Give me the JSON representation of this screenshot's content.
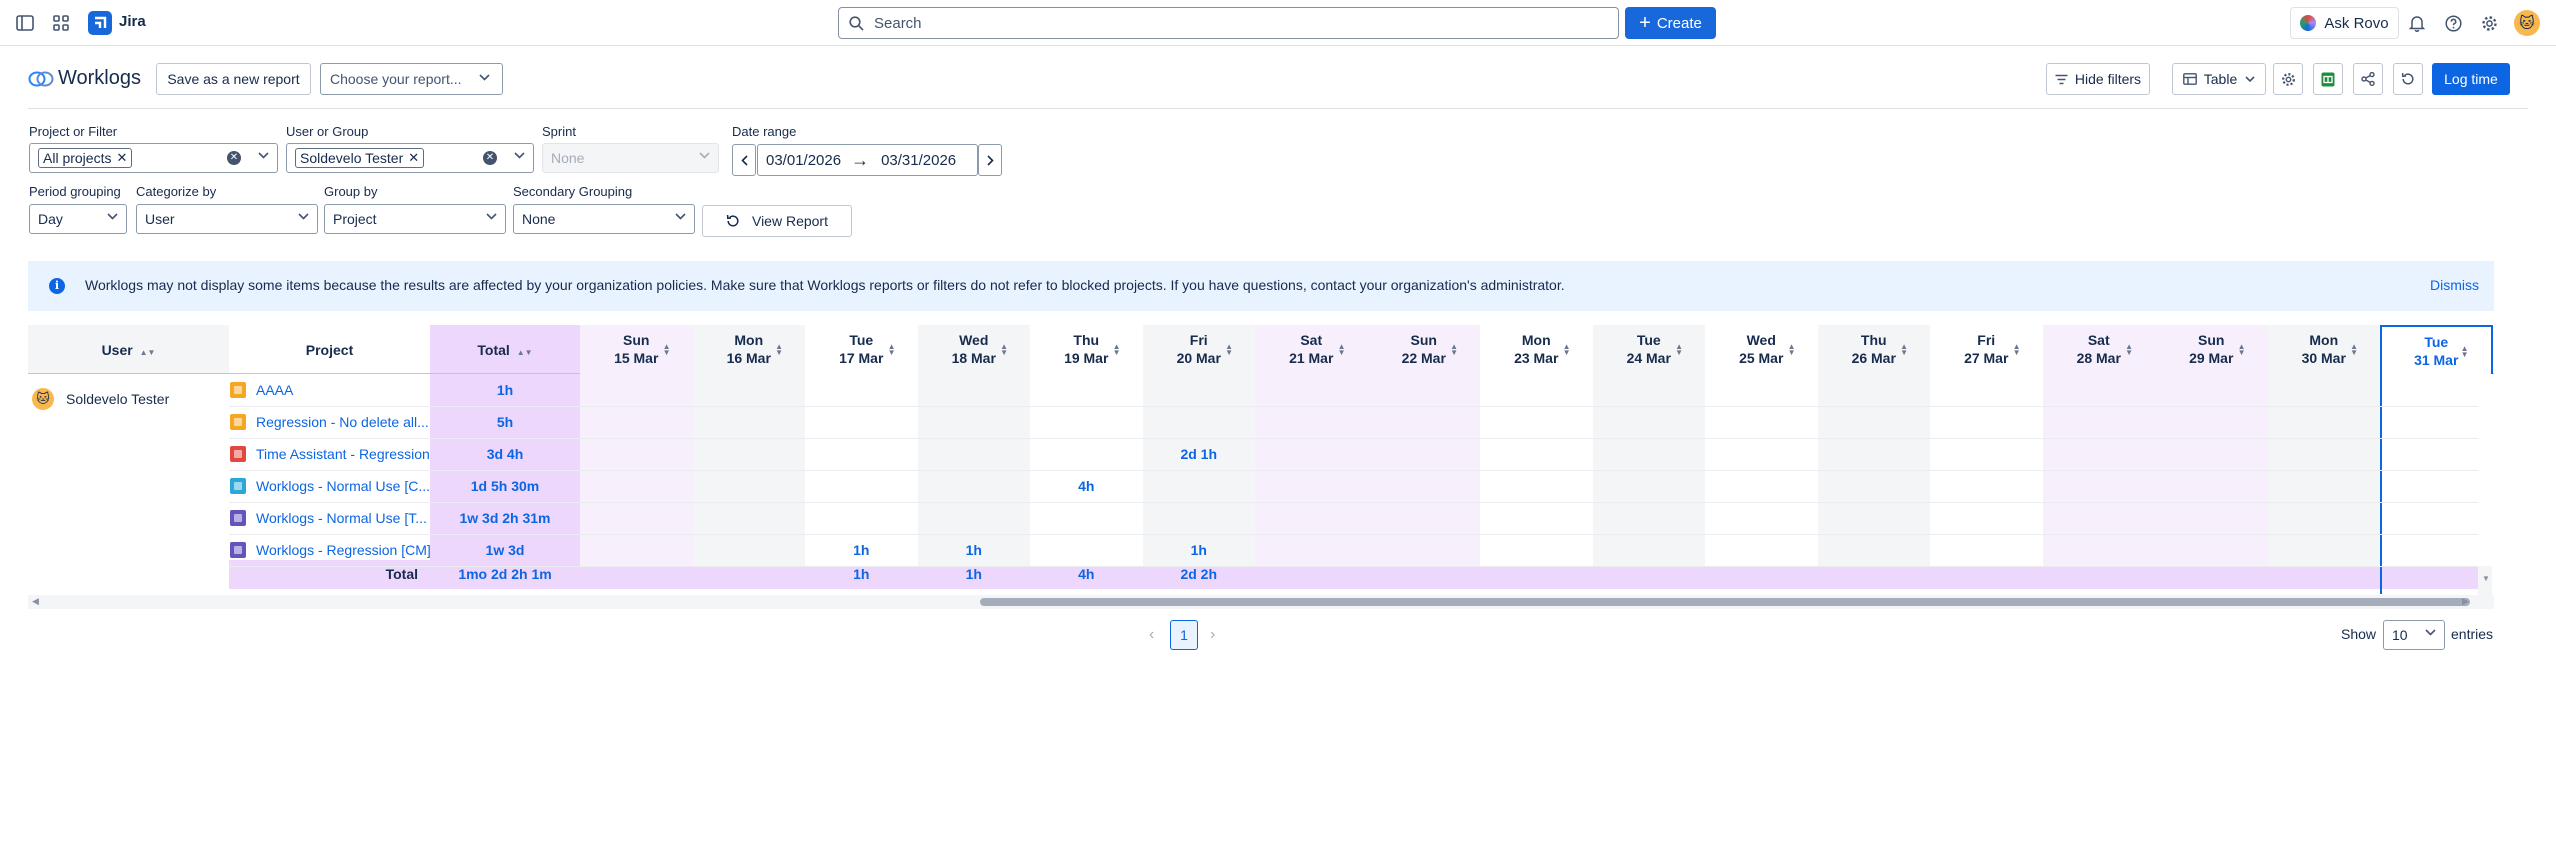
{
  "topnav": {
    "app_name": "Jira",
    "search_placeholder": "Search",
    "create_label": "Create",
    "ask_rovo_label": "Ask Rovo"
  },
  "header": {
    "title": "Worklogs",
    "save_new_report": "Save as a new report",
    "choose_report_placeholder": "Choose your report...",
    "hide_filters": "Hide filters",
    "view_mode": "Table",
    "log_time": "Log time"
  },
  "filters": {
    "project_label": "Project or Filter",
    "project_chip": "All projects",
    "user_label": "User or Group",
    "user_chip": "Soldevelo Tester",
    "sprint_label": "Sprint",
    "sprint_value": "None",
    "date_label": "Date range",
    "date_from": "03/01/2026",
    "date_to": "03/31/2026",
    "period_label": "Period grouping",
    "period_value": "Day",
    "categorize_label": "Categorize by",
    "categorize_value": "User",
    "group_label": "Group by",
    "group_value": "Project",
    "secondary_label": "Secondary Grouping",
    "secondary_value": "None",
    "view_report": "View Report"
  },
  "banner": {
    "message": "Worklogs may not display some items because the results are affected by your organization policies. Make sure that Worklogs reports or filters do not refer to blocked projects. If you have questions, contact your organization's administrator.",
    "dismiss": "Dismiss"
  },
  "table": {
    "col_user": "User",
    "col_project": "Project",
    "col_total": "Total",
    "days": [
      {
        "dow": "Sun",
        "date": "15 Mar",
        "weekend": true
      },
      {
        "dow": "Mon",
        "date": "16 Mar",
        "weekend": false
      },
      {
        "dow": "Tue",
        "date": "17 Mar",
        "weekend": false
      },
      {
        "dow": "Wed",
        "date": "18 Mar",
        "weekend": false
      },
      {
        "dow": "Thu",
        "date": "19 Mar",
        "weekend": false
      },
      {
        "dow": "Fri",
        "date": "20 Mar",
        "weekend": false
      },
      {
        "dow": "Sat",
        "date": "21 Mar",
        "weekend": true
      },
      {
        "dow": "Sun",
        "date": "22 Mar",
        "weekend": true
      },
      {
        "dow": "Mon",
        "date": "23 Mar",
        "weekend": false
      },
      {
        "dow": "Tue",
        "date": "24 Mar",
        "weekend": false
      },
      {
        "dow": "Wed",
        "date": "25 Mar",
        "weekend": false
      },
      {
        "dow": "Thu",
        "date": "26 Mar",
        "weekend": false
      },
      {
        "dow": "Fri",
        "date": "27 Mar",
        "weekend": false
      },
      {
        "dow": "Sat",
        "date": "28 Mar",
        "weekend": true
      },
      {
        "dow": "Sun",
        "date": "29 Mar",
        "weekend": true
      },
      {
        "dow": "Mon",
        "date": "30 Mar",
        "weekend": false
      },
      {
        "dow": "Tue",
        "date": "31 Mar",
        "weekend": false,
        "today": true
      }
    ],
    "user_name": "Soldevelo Tester",
    "rows": [
      {
        "project": "AAAA",
        "icon_color": "#f5a623",
        "total": "1h",
        "cells": [
          "",
          "",
          "",
          "",
          "",
          "",
          "",
          "",
          "",
          "",
          "",
          "",
          "",
          "",
          "",
          "",
          ""
        ]
      },
      {
        "project": "Regression - No delete all...",
        "icon_color": "#f5a623",
        "total": "5h",
        "cells": [
          "",
          "",
          "",
          "",
          "",
          "",
          "",
          "",
          "",
          "",
          "",
          "",
          "",
          "",
          "",
          "",
          ""
        ]
      },
      {
        "project": "Time Assistant - Regression",
        "icon_color": "#e2483d",
        "total": "3d 4h",
        "cells": [
          "",
          "",
          "",
          "",
          "",
          "2d 1h",
          "",
          "",
          "",
          "",
          "",
          "",
          "",
          "",
          "",
          "",
          ""
        ]
      },
      {
        "project": "Worklogs - Normal Use [C...",
        "icon_color": "#2ba8d8",
        "total": "1d 5h 30m",
        "cells": [
          "",
          "",
          "",
          "",
          "4h",
          "",
          "",
          "",
          "",
          "",
          "",
          "",
          "",
          "",
          "",
          "",
          ""
        ]
      },
      {
        "project": "Worklogs - Normal Use [T...",
        "icon_color": "#6554c0",
        "total": "1w 3d 2h 31m",
        "cells": [
          "",
          "",
          "",
          "",
          "",
          "",
          "",
          "",
          "",
          "",
          "",
          "",
          "",
          "",
          "",
          "",
          ""
        ]
      },
      {
        "project": "Worklogs - Regression [CM]",
        "icon_color": "#6554c0",
        "total": "1w 3d",
        "cells": [
          "",
          "",
          "1h",
          "1h",
          "",
          "1h",
          "",
          "",
          "",
          "",
          "",
          "",
          "",
          "",
          "",
          "",
          ""
        ]
      }
    ],
    "total_label": "Total",
    "grand_total": "1mo 2d 2h 1m",
    "day_totals": [
      "",
      "",
      "1h",
      "1h",
      "4h",
      "2d 2h",
      "",
      "",
      "",
      "",
      "",
      "",
      "",
      "",
      "",
      "",
      ""
    ]
  },
  "footer": {
    "page": "1",
    "show_label": "Show",
    "page_size": "10",
    "entries_label": "entries"
  },
  "colors": {
    "accent": "#0c66e4",
    "create_blue": "#1868db",
    "total_col": "#eed7fc",
    "weekend_col": "#f7f0fc",
    "weekday_alt": "#f4f5f7",
    "banner_bg": "#e9f2ff"
  }
}
